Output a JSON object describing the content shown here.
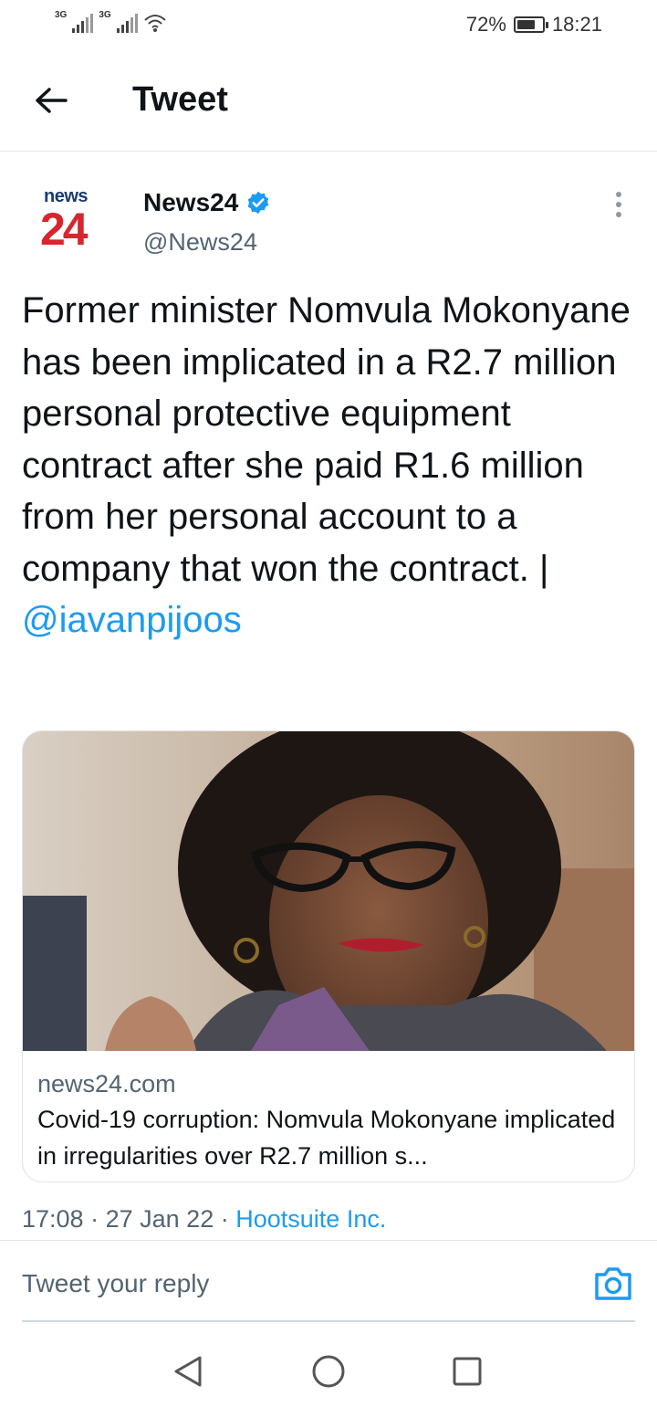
{
  "status_bar": {
    "network_1": "3G",
    "network_2": "3G",
    "battery_text": "72%",
    "battery_level": 0.72,
    "time": "18:21",
    "icons": [
      "signal-icon",
      "signal-icon",
      "wifi-icon",
      "battery-icon"
    ]
  },
  "header": {
    "title": "Tweet",
    "back_icon": "arrow-left-icon"
  },
  "tweet": {
    "avatar": {
      "top_text": "news",
      "number_text": "24"
    },
    "display_name": "News24",
    "verified_icon": "verified-badge-icon",
    "handle": "@News24",
    "more_icon": "more-vertical-icon",
    "text": "Former minister Nomvula Mokonyane has been implicated in a R2.7 million personal protective equipment contract after she paid R1.6 million from her personal account to a company that won the contract. |",
    "mention": "@iavanpijoos"
  },
  "card": {
    "domain": "news24.com",
    "title": "Covid-19 corruption: Nomvula Mokonyane implicated in irregularities over R2.7 million s..."
  },
  "meta": {
    "time": "17:08",
    "separator": "·",
    "date": "27 Jan 22",
    "source": "Hootsuite Inc."
  },
  "reply": {
    "placeholder": "Tweet your reply",
    "camera_icon": "camera-icon"
  },
  "nav": {
    "icons": [
      "back-triangle-icon",
      "home-circle-icon",
      "recents-square-icon"
    ]
  },
  "colors": {
    "accent": "#1d9bf0",
    "text": "#0f1419",
    "secondary": "#536471",
    "news24_red": "#d7262e",
    "news24_blue": "#1a3c6e"
  }
}
